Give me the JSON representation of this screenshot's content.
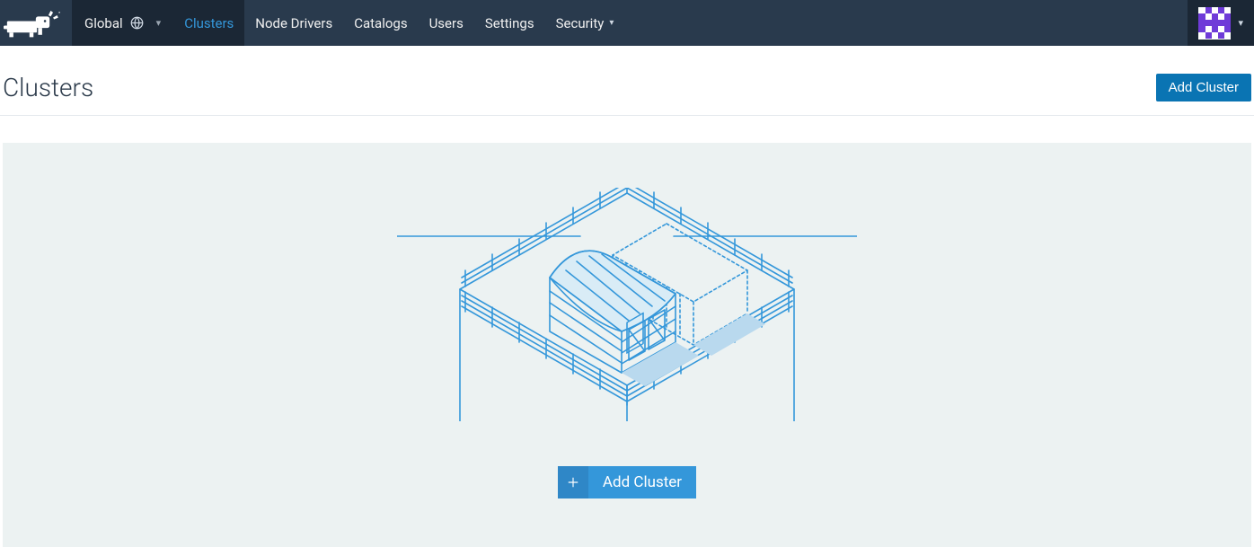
{
  "nav": {
    "scope_label": "Global",
    "items": [
      {
        "label": "Clusters",
        "active": true
      },
      {
        "label": "Node Drivers",
        "active": false
      },
      {
        "label": "Catalogs",
        "active": false
      },
      {
        "label": "Users",
        "active": false
      },
      {
        "label": "Settings",
        "active": false
      },
      {
        "label": "Security",
        "active": false,
        "has_dropdown": true
      }
    ]
  },
  "page": {
    "title": "Clusters",
    "add_button": "Add Cluster"
  },
  "empty": {
    "add_button": "Add Cluster"
  },
  "colors": {
    "nav_bg": "#293a4d",
    "nav_dark": "#1b2735",
    "accent": "#3497da",
    "primary_btn": "#0a74b3",
    "empty_bg": "#ecf2f2",
    "avatar": "#6f3bd8"
  }
}
